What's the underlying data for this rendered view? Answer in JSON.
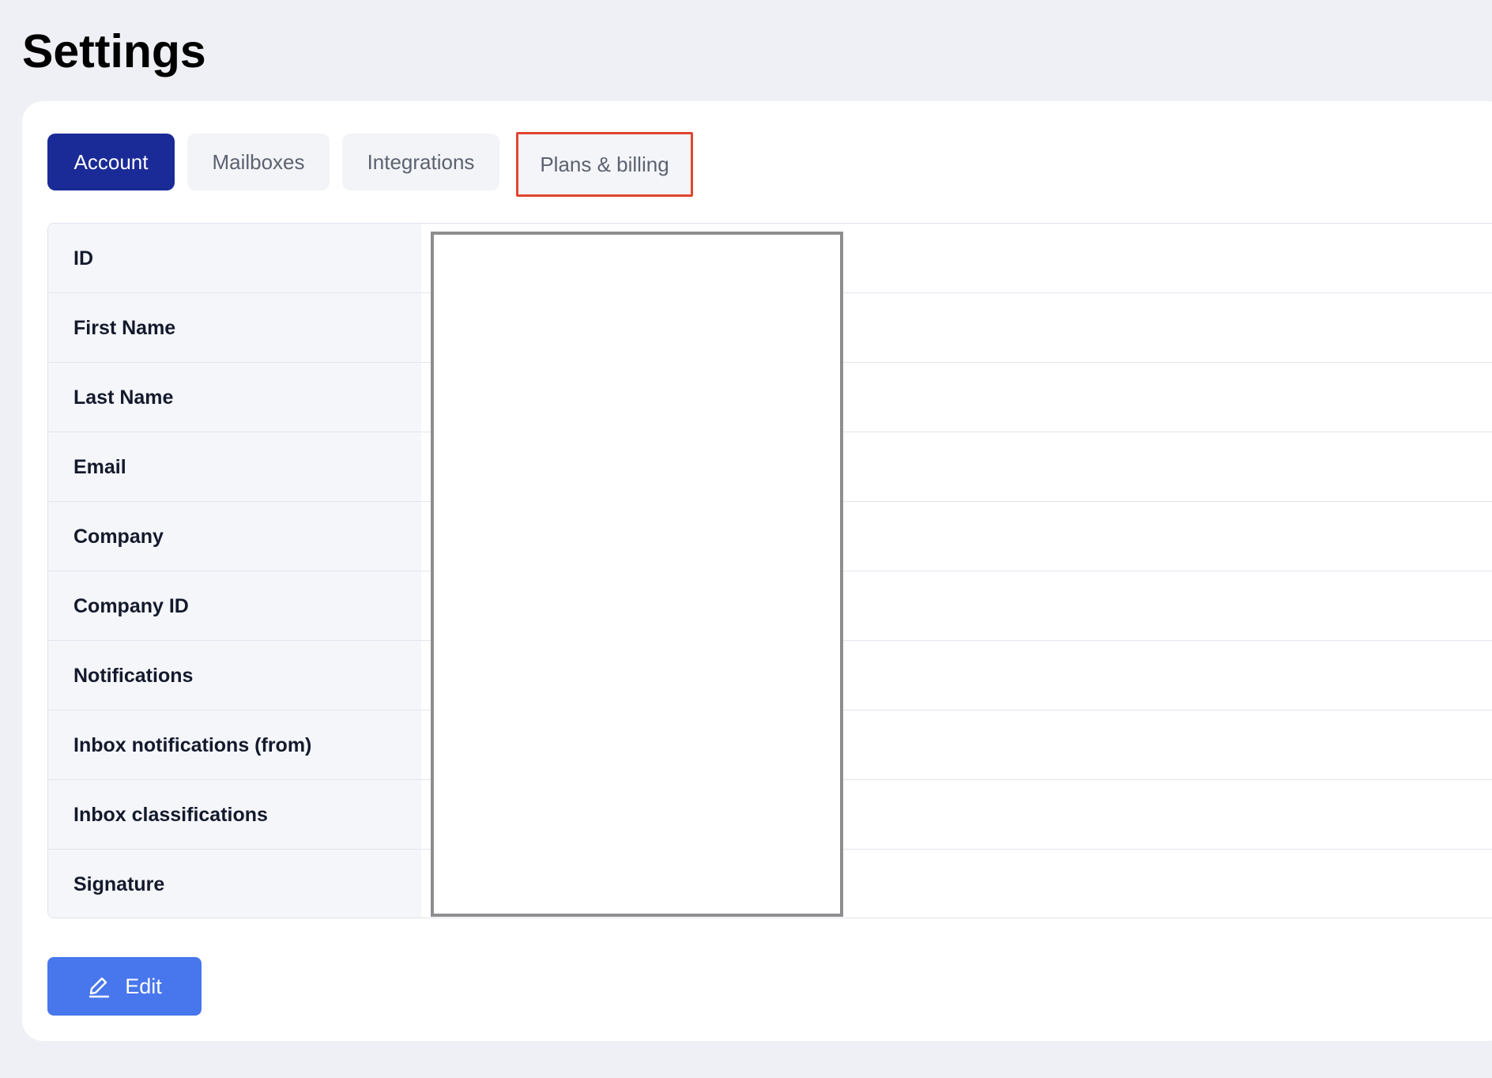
{
  "page": {
    "title": "Settings"
  },
  "tabs": [
    {
      "label": "Account",
      "active": true
    },
    {
      "label": "Mailboxes",
      "active": false
    },
    {
      "label": "Integrations",
      "active": false
    },
    {
      "label": "Plans & billing",
      "active": false
    }
  ],
  "account_fields": [
    {
      "label": "ID"
    },
    {
      "label": "First Name"
    },
    {
      "label": "Last Name"
    },
    {
      "label": "Email"
    },
    {
      "label": "Company"
    },
    {
      "label": "Company ID"
    },
    {
      "label": "Notifications"
    },
    {
      "label": "Inbox notifications (from)"
    },
    {
      "label": "Inbox classifications"
    },
    {
      "label": "Signature"
    }
  ],
  "actions": {
    "edit_label": "Edit",
    "edit_icon": "pencil-icon"
  },
  "colors": {
    "active_tab": "#1a2a96",
    "edit_button": "#4876ec",
    "highlight_border": "#e0452f"
  }
}
